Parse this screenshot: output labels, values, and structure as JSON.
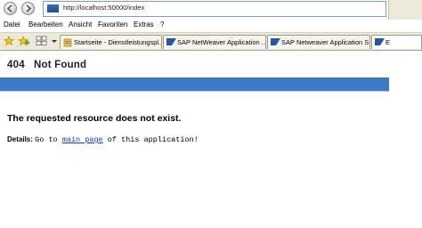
{
  "browser": {
    "address": "http://localhost:50000/index",
    "menu": [
      "Datei",
      "Bearbeiten",
      "Ansicht",
      "Favoriten",
      "Extras",
      "?"
    ],
    "tabs": [
      {
        "label": "Startseite - Dienstleistungspl...",
        "icon": "document-icon"
      },
      {
        "label": "SAP NetWeaver Application ...",
        "icon": "sap-icon"
      },
      {
        "label": "SAP Netweaver Application S...",
        "icon": "sap-icon"
      },
      {
        "label": "E",
        "icon": "sap-icon"
      }
    ]
  },
  "page": {
    "title": "404   Not Found",
    "message": "The requested resource does not exist.",
    "details_label": "Details:",
    "details_prefix": "Go to ",
    "link_text": "main page",
    "details_suffix": " of this application!"
  },
  "colors": {
    "title_bar": "#3a7bc4",
    "link": "#0b3fb5"
  }
}
